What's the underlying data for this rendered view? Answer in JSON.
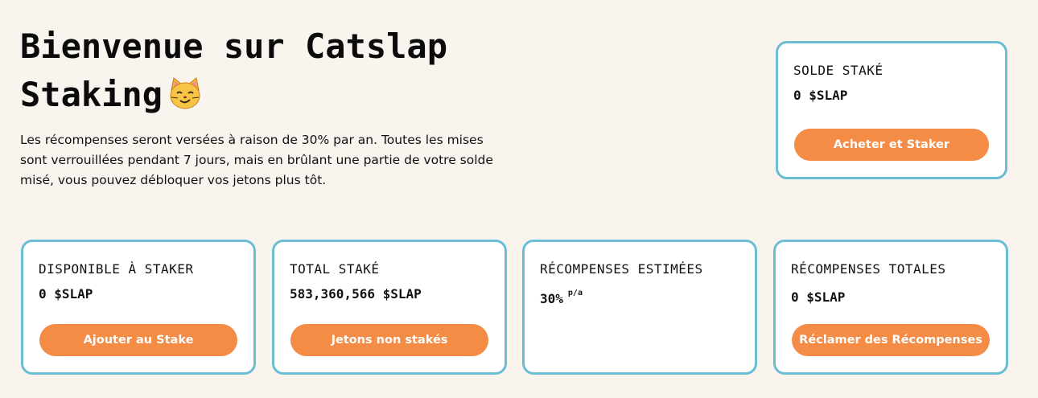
{
  "hero": {
    "title": "Bienvenue sur Catslap Staking",
    "description": "Les récompenses seront versées à raison de 30% par an. Toutes les mises sont verrouillées pendant 7 jours, mais en brûlant une partie de votre solde misé, vous pouvez débloquer vos jetons plus tôt.",
    "emoji": "cat-face-icon"
  },
  "staked_balance": {
    "label": "SOLDE STAKÉ",
    "value": "0 $SLAP",
    "button": "Acheter et Staker"
  },
  "cards": {
    "available": {
      "label": "DISPONIBLE À STAKER",
      "value": "0 $SLAP",
      "button": "Ajouter au Stake"
    },
    "total_staked": {
      "label": "TOTAL STAKÉ",
      "value": "583,360,566 $SLAP",
      "button": "Jetons non stakés"
    },
    "estimated_rewards": {
      "label": "RÉCOMPENSES ESTIMÉES",
      "value": "30%",
      "suffix": "p/a"
    },
    "total_rewards": {
      "label": "RÉCOMPENSES TOTALES",
      "value": "0 $SLAP",
      "button": "Réclamer des Récompenses"
    }
  },
  "colors": {
    "background": "#f9f4ee",
    "card_border": "#6bbdd3",
    "button": "#f48c45",
    "button_text": "#ffffff"
  }
}
